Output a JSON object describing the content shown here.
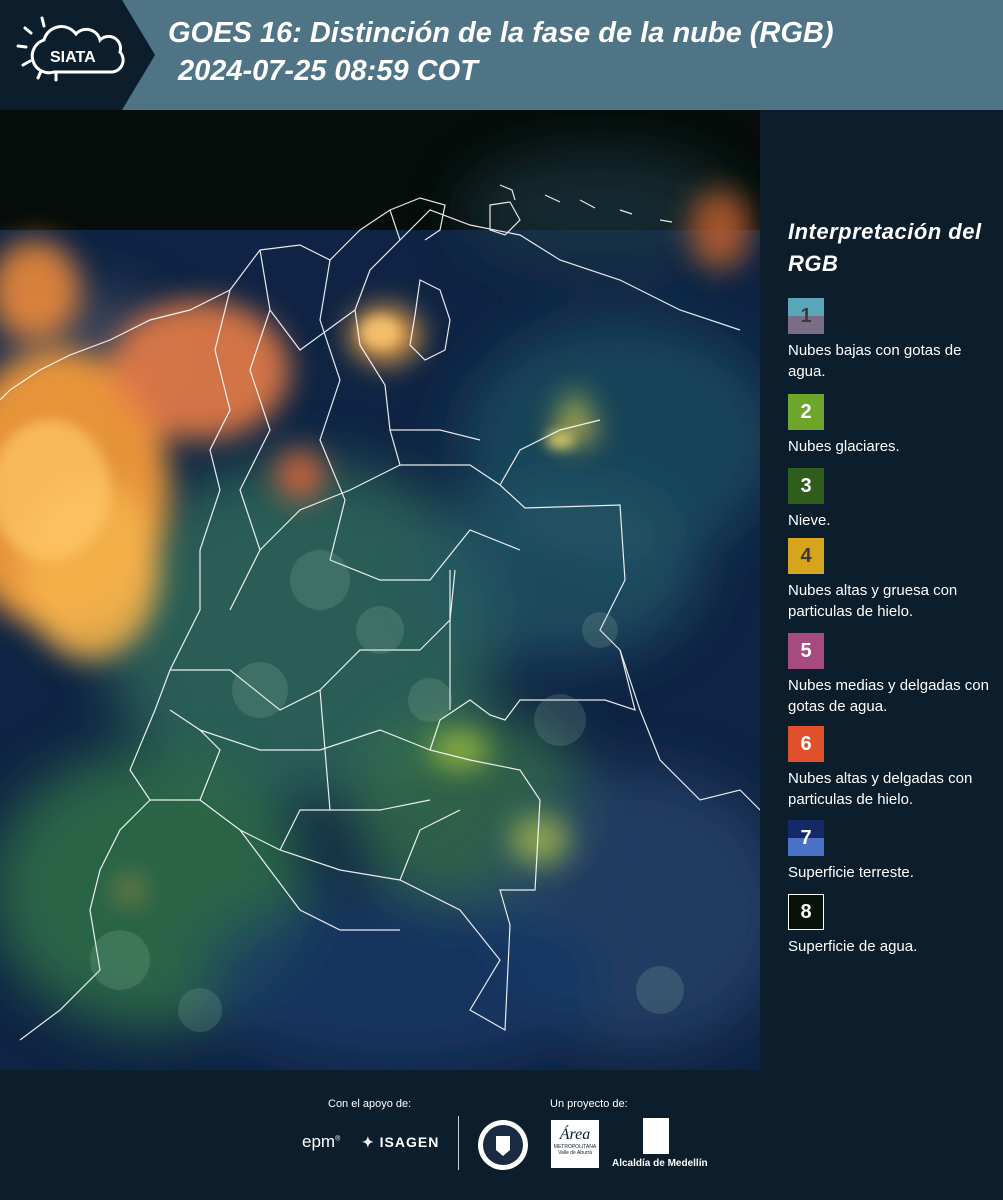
{
  "header": {
    "brand": "SIATA",
    "title_line1": "GOES 16: Distinción de la fase de la nube (RGB)",
    "title_line2": "2024-07-25 08:59 COT"
  },
  "legend": {
    "title": "Interpretación del RGB",
    "items": [
      {
        "number": "1",
        "label": "Nubes bajas con gotas de agua.",
        "color_top": "#5aa6b9",
        "color_bottom": "#7a6d87"
      },
      {
        "number": "2",
        "label": "Nubes glaciares.",
        "color_top": "#6ea52b",
        "color_bottom": "#6ea52b"
      },
      {
        "number": "3",
        "label": "Nieve.",
        "color_top": "#2f5d1c",
        "color_bottom": "#2f5d1c"
      },
      {
        "number": "4",
        "label": "Nubes altas y gruesa con particulas de hielo.",
        "color_top": "#d7a51d",
        "color_bottom": "#d7a51d"
      },
      {
        "number": "5",
        "label": "Nubes medias y delgadas con gotas de agua.",
        "color_top": "#a54b80",
        "color_bottom": "#a54b80"
      },
      {
        "number": "6",
        "label": "Nubes altas y delgadas con particulas de hielo.",
        "color_top": "#e0512b",
        "color_bottom": "#e0512b"
      },
      {
        "number": "7",
        "label": "Superficie terreste.",
        "color_top": "#152966",
        "color_bottom": "#4b71c6"
      },
      {
        "number": "8",
        "label": "Superficie de agua.",
        "color_top": "#081208",
        "color_bottom": "#081208"
      }
    ]
  },
  "footer": {
    "support_caption": "Con el apoyo de:",
    "project_caption": "Un proyecto de:",
    "sponsor_epm": "epm",
    "sponsor_isagen": "ISAGEN",
    "metro_logo_text": "Área",
    "metro_sub_1": "METROPOLITANA",
    "metro_sub_2": "Valle de Aburrá",
    "medellin_label": "Alcaldía de Medellín"
  }
}
